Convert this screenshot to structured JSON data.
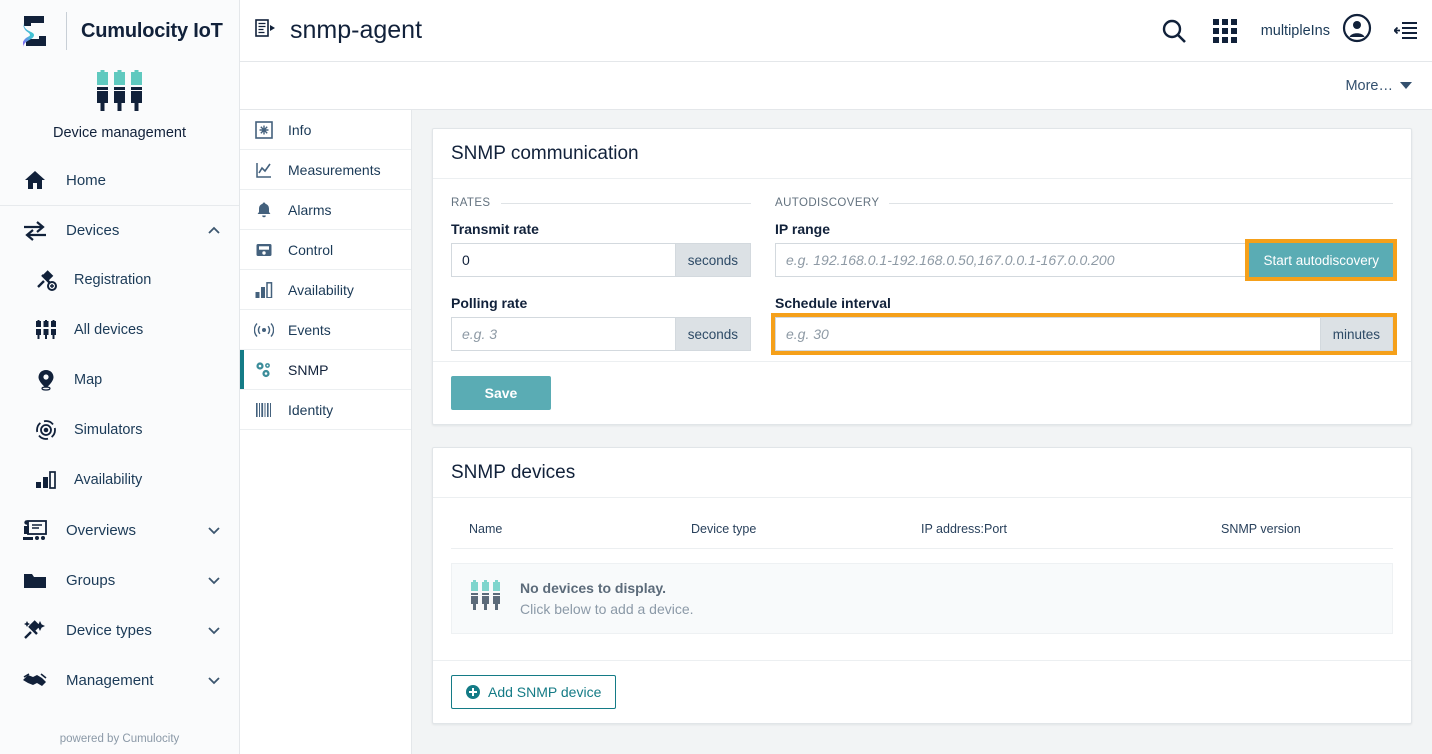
{
  "brand": {
    "title": "Cumulocity IoT",
    "logo_icon": "cumulocity-s-logo",
    "app_name": "Device management",
    "app_icon": "device-management-icon",
    "footer": "powered by Cumulocity"
  },
  "nav": {
    "items": [
      {
        "label": "Home",
        "icon": "home-icon",
        "level": "top",
        "expandable": false,
        "divider": false
      },
      {
        "label": "Devices",
        "icon": "devices-transfer-icon",
        "level": "top",
        "expandable": true,
        "expanded": true,
        "chevron": "chevron-up-icon",
        "divider": true
      },
      {
        "label": "Registration",
        "icon": "registration-plug-icon",
        "level": "sub"
      },
      {
        "label": "All devices",
        "icon": "all-devices-icon",
        "level": "sub"
      },
      {
        "label": "Map",
        "icon": "map-pin-icon",
        "level": "sub"
      },
      {
        "label": "Simulators",
        "icon": "simulators-icon",
        "level": "sub"
      },
      {
        "label": "Availability",
        "icon": "availability-bars-icon",
        "level": "sub"
      },
      {
        "label": "Overviews",
        "icon": "overviews-icon",
        "level": "top",
        "expandable": true,
        "expanded": false,
        "chevron": "chevron-down-icon"
      },
      {
        "label": "Groups",
        "icon": "folder-icon",
        "level": "top",
        "expandable": true,
        "expanded": false,
        "chevron": "chevron-down-icon"
      },
      {
        "label": "Device types",
        "icon": "device-types-icon",
        "level": "top",
        "expandable": true,
        "expanded": false,
        "chevron": "chevron-down-icon"
      },
      {
        "label": "Management",
        "icon": "handshake-icon",
        "level": "top",
        "expandable": true,
        "expanded": false,
        "chevron": "chevron-down-icon"
      }
    ]
  },
  "header": {
    "doc_icon": "device-page-icon",
    "title": "snmp-agent",
    "search_icon": "search-icon",
    "apps_icon": "app-grid-icon",
    "user_name": "multipleIns",
    "user_avatar_icon": "user-avatar-icon",
    "right_drawer_icon": "right-drawer-toggle-icon"
  },
  "subheader": {
    "more_label": "More…",
    "more_caret_icon": "caret-down-icon"
  },
  "device_tabs": [
    {
      "label": "Info",
      "icon": "info-icon",
      "active": false
    },
    {
      "label": "Measurements",
      "icon": "measurements-chart-icon",
      "active": false
    },
    {
      "label": "Alarms",
      "icon": "bell-icon",
      "active": false
    },
    {
      "label": "Control",
      "icon": "control-icon",
      "active": false
    },
    {
      "label": "Availability",
      "icon": "availability-bars-icon",
      "active": false
    },
    {
      "label": "Events",
      "icon": "events-signal-icon",
      "active": false
    },
    {
      "label": "SNMP",
      "icon": "snmp-gears-icon",
      "active": true
    },
    {
      "label": "Identity",
      "icon": "barcode-icon",
      "active": false
    }
  ],
  "snmp_communication": {
    "title": "SNMP communication",
    "rates_legend": "RATES",
    "autodiscovery_legend": "AUTODISCOVERY",
    "transmit_rate": {
      "label": "Transmit rate",
      "value": "0",
      "placeholder": "",
      "unit": "seconds"
    },
    "polling_rate": {
      "label": "Polling rate",
      "value": "",
      "placeholder": "e.g. 3",
      "unit": "seconds"
    },
    "ip_range": {
      "label": "IP range",
      "value": "",
      "placeholder": "e.g. 192.168.0.1-192.168.0.50,167.0.0.1-167.0.0.200",
      "button_label": "Start autodiscovery",
      "button_highlighted": true
    },
    "schedule_interval": {
      "label": "Schedule interval",
      "value": "",
      "placeholder": "e.g. 30",
      "unit": "minutes",
      "highlighted": true
    },
    "save_label": "Save"
  },
  "snmp_devices": {
    "title": "SNMP devices",
    "columns": [
      "Name",
      "Device type",
      "IP address:Port",
      "SNMP version"
    ],
    "rows": [],
    "empty_icon": "device-management-icon",
    "empty_title": "No devices to display.",
    "empty_subtitle": "Click below to add a device.",
    "add_button_label": "Add SNMP device",
    "add_button_icon": "plus-circle-icon"
  },
  "colors": {
    "accent_teal": "#5aacb4",
    "active_tab_teal": "#147b86",
    "highlight_orange": "#f5a01a",
    "brand_navy": "#11213a",
    "app_icon_teal": "#5fc9bf",
    "content_bg": "#f2f4f5"
  }
}
